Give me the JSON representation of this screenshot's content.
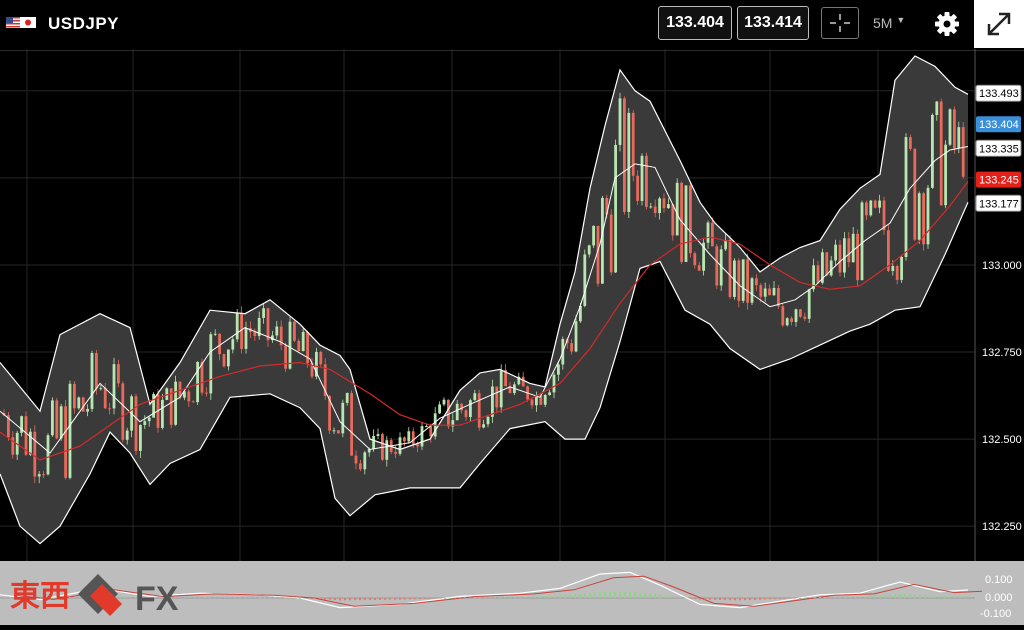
{
  "header": {
    "symbol": "USDJPY",
    "bid": "133.404",
    "ask": "133.414",
    "timeframe": "5M",
    "icons": [
      "us-flag-icon",
      "japan-flag-icon",
      "crosshair-icon",
      "caret-down-icon",
      "gear-icon",
      "expand-icon"
    ]
  },
  "price_axis": {
    "ticks": [
      "133.000",
      "132.750",
      "132.500",
      "132.250"
    ],
    "markers": {
      "upper_band": "133.493",
      "current": "133.404",
      "middle_band": "133.335",
      "moving_average": "133.245",
      "lower_band": "133.177"
    }
  },
  "oscillator_axis": {
    "ticks": [
      "0.100",
      "0.000",
      "-0.100"
    ]
  },
  "logo": {
    "text_cjk": "東西",
    "text_fx": "FX"
  },
  "colors": {
    "background": "#000000",
    "band_fill": "#3a3a3a",
    "band_line": "#ffffff",
    "ma_line": "#d42a2a",
    "bull_candle": "#b8e6b0",
    "bear_candle": "#e86a5a",
    "current_price": "#3b8fd9",
    "ma_marker": "#e4201b"
  },
  "chart_data": {
    "type": "line",
    "title": "",
    "y_range": [
      132.15,
      133.62
    ],
    "series_upper_band": [
      [
        0,
        132.72
      ],
      [
        40,
        132.58
      ],
      [
        60,
        132.8
      ],
      [
        100,
        132.86
      ],
      [
        130,
        132.82
      ],
      [
        150,
        132.6
      ],
      [
        180,
        132.72
      ],
      [
        210,
        132.87
      ],
      [
        245,
        132.86
      ],
      [
        270,
        132.9
      ],
      [
        300,
        132.83
      ],
      [
        320,
        132.77
      ],
      [
        340,
        132.74
      ],
      [
        350,
        132.7
      ],
      [
        370,
        132.5
      ],
      [
        400,
        132.47
      ],
      [
        430,
        132.5
      ],
      [
        460,
        132.64
      ],
      [
        480,
        132.69
      ],
      [
        500,
        132.7
      ],
      [
        530,
        132.66
      ],
      [
        545,
        132.65
      ],
      [
        560,
        132.83
      ],
      [
        575,
        132.98
      ],
      [
        590,
        133.22
      ],
      [
        605,
        133.4
      ],
      [
        620,
        133.56
      ],
      [
        635,
        133.5
      ],
      [
        650,
        133.47
      ],
      [
        680,
        133.3
      ],
      [
        700,
        133.18
      ],
      [
        715,
        133.12
      ],
      [
        740,
        133.05
      ],
      [
        760,
        132.98
      ],
      [
        780,
        133.02
      ],
      [
        800,
        133.05
      ],
      [
        820,
        133.07
      ],
      [
        840,
        133.16
      ],
      [
        860,
        133.22
      ],
      [
        880,
        133.26
      ],
      [
        895,
        133.53
      ],
      [
        915,
        133.6
      ],
      [
        935,
        133.57
      ],
      [
        955,
        133.51
      ],
      [
        968,
        133.49
      ]
    ],
    "series_middle_band": [
      [
        0,
        132.58
      ],
      [
        50,
        132.46
      ],
      [
        100,
        132.66
      ],
      [
        140,
        132.55
      ],
      [
        180,
        132.62
      ],
      [
        210,
        132.75
      ],
      [
        245,
        132.82
      ],
      [
        280,
        132.78
      ],
      [
        310,
        132.73
      ],
      [
        340,
        132.55
      ],
      [
        370,
        132.47
      ],
      [
        410,
        132.49
      ],
      [
        440,
        132.56
      ],
      [
        470,
        132.6
      ],
      [
        510,
        132.65
      ],
      [
        540,
        132.62
      ],
      [
        560,
        132.73
      ],
      [
        580,
        132.88
      ],
      [
        600,
        133.06
      ],
      [
        615,
        133.25
      ],
      [
        635,
        133.29
      ],
      [
        655,
        133.28
      ],
      [
        680,
        133.13
      ],
      [
        710,
        133.03
      ],
      [
        740,
        132.94
      ],
      [
        770,
        132.88
      ],
      [
        795,
        132.9
      ],
      [
        815,
        132.94
      ],
      [
        840,
        133.01
      ],
      [
        865,
        133.07
      ],
      [
        890,
        133.12
      ],
      [
        910,
        133.22
      ],
      [
        935,
        133.3
      ],
      [
        950,
        133.33
      ],
      [
        968,
        133.34
      ]
    ],
    "series_lower_band": [
      [
        0,
        132.4
      ],
      [
        20,
        132.25
      ],
      [
        40,
        132.2
      ],
      [
        60,
        132.25
      ],
      [
        90,
        132.4
      ],
      [
        110,
        132.52
      ],
      [
        130,
        132.46
      ],
      [
        150,
        132.37
      ],
      [
        170,
        132.43
      ],
      [
        200,
        132.47
      ],
      [
        230,
        132.62
      ],
      [
        270,
        132.63
      ],
      [
        300,
        132.59
      ],
      [
        320,
        132.53
      ],
      [
        335,
        132.33
      ],
      [
        350,
        132.28
      ],
      [
        375,
        132.34
      ],
      [
        410,
        132.36
      ],
      [
        440,
        132.36
      ],
      [
        460,
        132.36
      ],
      [
        480,
        132.43
      ],
      [
        510,
        132.53
      ],
      [
        545,
        132.55
      ],
      [
        565,
        132.5
      ],
      [
        585,
        132.5
      ],
      [
        600,
        132.59
      ],
      [
        620,
        132.78
      ],
      [
        640,
        132.99
      ],
      [
        660,
        133.01
      ],
      [
        685,
        132.87
      ],
      [
        710,
        132.83
      ],
      [
        730,
        132.76
      ],
      [
        760,
        132.7
      ],
      [
        790,
        132.73
      ],
      [
        820,
        132.77
      ],
      [
        850,
        132.81
      ],
      [
        870,
        132.83
      ],
      [
        895,
        132.87
      ],
      [
        920,
        132.88
      ],
      [
        945,
        133.03
      ],
      [
        968,
        133.18
      ]
    ],
    "series_moving_average": [
      [
        0,
        132.52
      ],
      [
        40,
        132.44
      ],
      [
        80,
        132.48
      ],
      [
        100,
        132.52
      ],
      [
        140,
        132.6
      ],
      [
        180,
        132.64
      ],
      [
        220,
        132.68
      ],
      [
        260,
        132.71
      ],
      [
        300,
        132.72
      ],
      [
        330,
        132.7
      ],
      [
        370,
        132.63
      ],
      [
        400,
        132.57
      ],
      [
        430,
        132.54
      ],
      [
        460,
        132.54
      ],
      [
        490,
        132.57
      ],
      [
        520,
        132.6
      ],
      [
        560,
        132.66
      ],
      [
        590,
        132.76
      ],
      [
        620,
        132.89
      ],
      [
        650,
        133.0
      ],
      [
        680,
        133.06
      ],
      [
        710,
        133.08
      ],
      [
        740,
        133.06
      ],
      [
        770,
        133.0
      ],
      [
        800,
        132.95
      ],
      [
        830,
        132.93
      ],
      [
        860,
        132.94
      ],
      [
        890,
        133.0
      ],
      [
        920,
        133.07
      ],
      [
        950,
        133.17
      ],
      [
        968,
        133.24
      ]
    ],
    "oscillator": {
      "ticks": [
        "0.100",
        "0.000",
        "-0.100"
      ]
    }
  }
}
